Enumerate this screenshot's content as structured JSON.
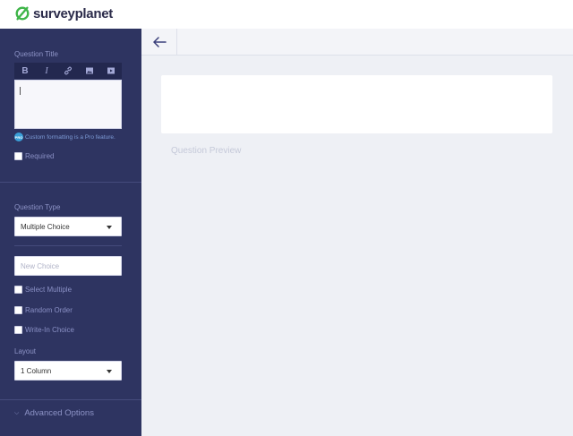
{
  "brand": {
    "name": "surveyplanet",
    "accent": "#3fb549"
  },
  "sidebar": {
    "question_title_label": "Question Title",
    "toolbar": [
      {
        "name": "bold-icon",
        "glyph": "B"
      },
      {
        "name": "italic-icon",
        "glyph": "I"
      },
      {
        "name": "link-icon",
        "glyph": "link"
      },
      {
        "name": "image-icon",
        "glyph": "image"
      },
      {
        "name": "video-icon",
        "glyph": "video"
      }
    ],
    "editor_value": "",
    "pro_badge": "PRO",
    "pro_note": "Custom formatting is a Pro feature.",
    "required_label": "Required",
    "question_type_label": "Question Type",
    "question_type_value": "Multiple Choice",
    "new_choice_placeholder": "New Choice",
    "select_multiple_label": "Select Multiple",
    "random_order_label": "Random Order",
    "write_in_label": "Write-In Choice",
    "layout_label": "Layout",
    "layout_value": "1 Column",
    "advanced_options_label": "Advanced Options"
  },
  "main": {
    "preview_label": "Question Preview"
  }
}
